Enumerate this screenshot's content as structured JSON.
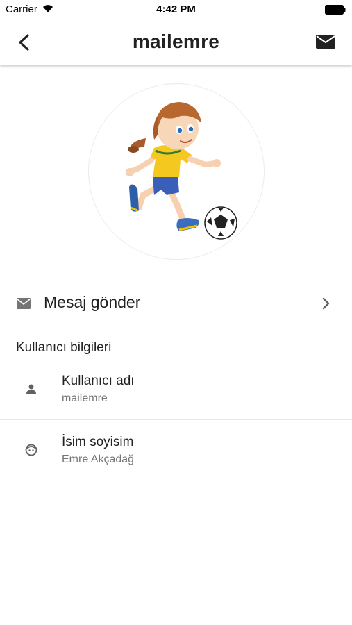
{
  "status_bar": {
    "carrier": "Carrier",
    "time": "4:42 PM",
    "wifi_icon": "wifi-icon",
    "battery_icon": "battery-icon"
  },
  "nav": {
    "title": "mailemre",
    "back_icon": "chevron-left-icon",
    "mail_icon": "mail-icon"
  },
  "avatar": {
    "description": "cartoon girl kicking a soccer ball"
  },
  "send_message": {
    "label": "Mesaj gönder",
    "icon": "mail-icon",
    "chevron_icon": "chevron-right-icon"
  },
  "user_info": {
    "section_title": "Kullanıcı bilgileri",
    "rows": [
      {
        "label": "Kullanıcı adı",
        "value": "mailemre",
        "icon": "person-icon"
      },
      {
        "label": "İsim soyisim",
        "value": "Emre Akçadağ",
        "icon": "face-icon"
      }
    ]
  },
  "colors": {
    "icon_gray": "#757575",
    "text_primary": "#212121",
    "text_secondary": "#757575",
    "divider": "#e6e6e6"
  }
}
